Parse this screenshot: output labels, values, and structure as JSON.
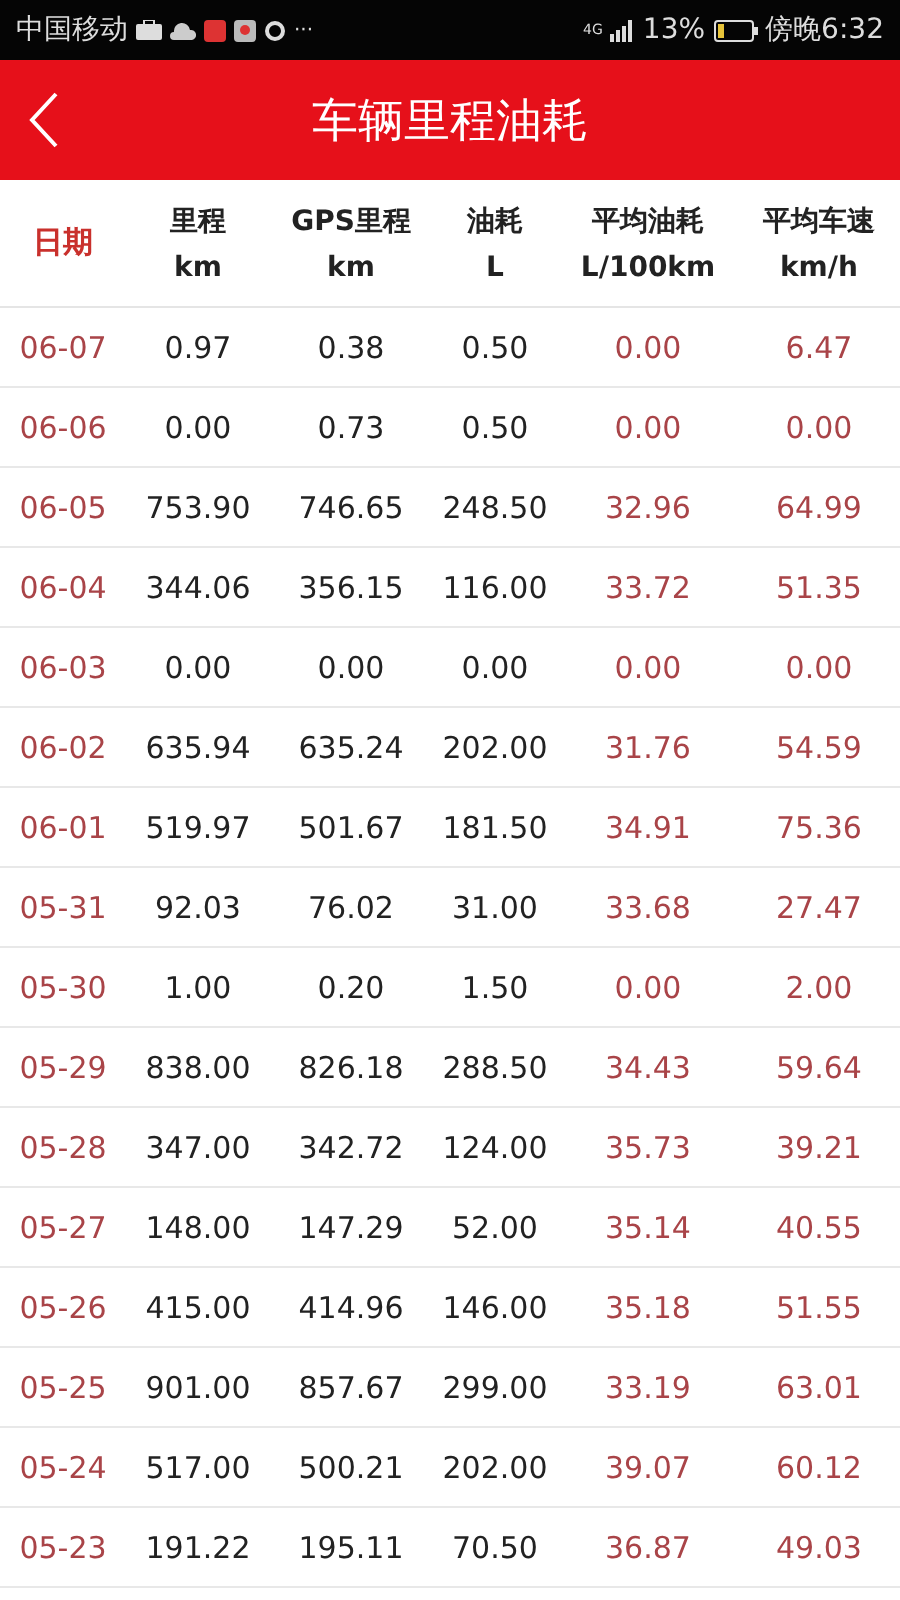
{
  "status_bar": {
    "carrier": "中国移动",
    "more": "···",
    "network": "4G",
    "battery": "13%",
    "time": "傍晚6:32"
  },
  "header": {
    "title": "车辆里程油耗"
  },
  "table": {
    "columns": [
      {
        "label": "日期"
      },
      {
        "label": "里程",
        "unit": "km"
      },
      {
        "label": "GPS里程",
        "unit": "km"
      },
      {
        "label": "油耗",
        "unit": "L"
      },
      {
        "label": "平均油耗",
        "unit": "L/100km"
      },
      {
        "label": "平均车速",
        "unit": "km/h"
      }
    ],
    "rows": [
      [
        "06-07",
        "0.97",
        "0.38",
        "0.50",
        "0.00",
        "6.47"
      ],
      [
        "06-06",
        "0.00",
        "0.73",
        "0.50",
        "0.00",
        "0.00"
      ],
      [
        "06-05",
        "753.90",
        "746.65",
        "248.50",
        "32.96",
        "64.99"
      ],
      [
        "06-04",
        "344.06",
        "356.15",
        "116.00",
        "33.72",
        "51.35"
      ],
      [
        "06-03",
        "0.00",
        "0.00",
        "0.00",
        "0.00",
        "0.00"
      ],
      [
        "06-02",
        "635.94",
        "635.24",
        "202.00",
        "31.76",
        "54.59"
      ],
      [
        "06-01",
        "519.97",
        "501.67",
        "181.50",
        "34.91",
        "75.36"
      ],
      [
        "05-31",
        "92.03",
        "76.02",
        "31.00",
        "33.68",
        "27.47"
      ],
      [
        "05-30",
        "1.00",
        "0.20",
        "1.50",
        "0.00",
        "2.00"
      ],
      [
        "05-29",
        "838.00",
        "826.18",
        "288.50",
        "34.43",
        "59.64"
      ],
      [
        "05-28",
        "347.00",
        "342.72",
        "124.00",
        "35.73",
        "39.21"
      ],
      [
        "05-27",
        "148.00",
        "147.29",
        "52.00",
        "35.14",
        "40.55"
      ],
      [
        "05-26",
        "415.00",
        "414.96",
        "146.00",
        "35.18",
        "51.55"
      ],
      [
        "05-25",
        "901.00",
        "857.67",
        "299.00",
        "33.19",
        "63.01"
      ],
      [
        "05-24",
        "517.00",
        "500.21",
        "202.00",
        "39.07",
        "60.12"
      ],
      [
        "05-23",
        "191.22",
        "195.11",
        "70.50",
        "36.87",
        "49.03"
      ]
    ]
  }
}
